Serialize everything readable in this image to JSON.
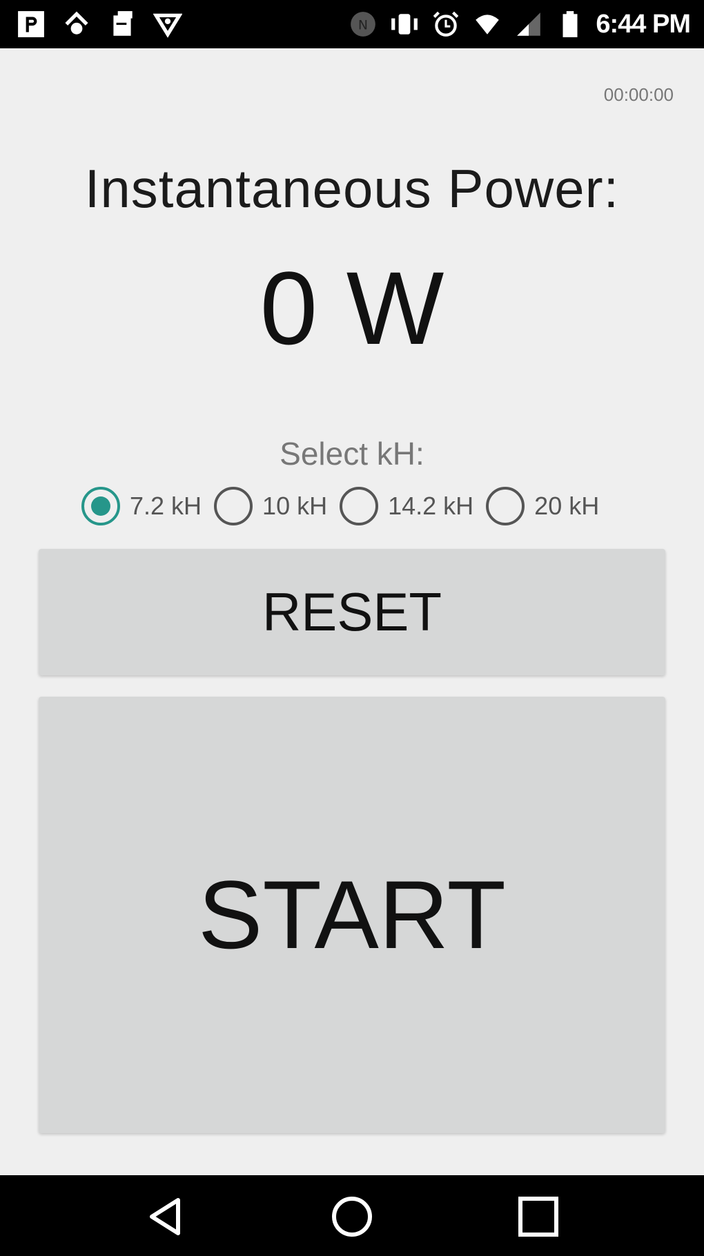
{
  "status_bar": {
    "time": "6:44 PM",
    "left_icons": [
      "parking-icon",
      "sync-icon",
      "document-icon",
      "shield-icon"
    ],
    "right_icons": [
      "nfc-icon",
      "vibrate-icon",
      "alarm-icon",
      "wifi-icon",
      "signal-icon",
      "battery-icon"
    ]
  },
  "main": {
    "timer": "00:00:00",
    "power_label": "Instantaneous Power:",
    "power_value": "0 W",
    "select_label": "Select kH:",
    "options": [
      {
        "label": "7.2 kH",
        "selected": true
      },
      {
        "label": "10 kH",
        "selected": false
      },
      {
        "label": "14.2 kH",
        "selected": false
      },
      {
        "label": "20 kH",
        "selected": false
      }
    ],
    "reset_label": "RESET",
    "start_label": "START"
  },
  "nav_bar": {
    "icons": [
      "back-icon",
      "home-icon",
      "recents-icon"
    ]
  },
  "colors": {
    "accent": "#26968a",
    "background": "#efefef",
    "button": "#d6d7d7"
  }
}
